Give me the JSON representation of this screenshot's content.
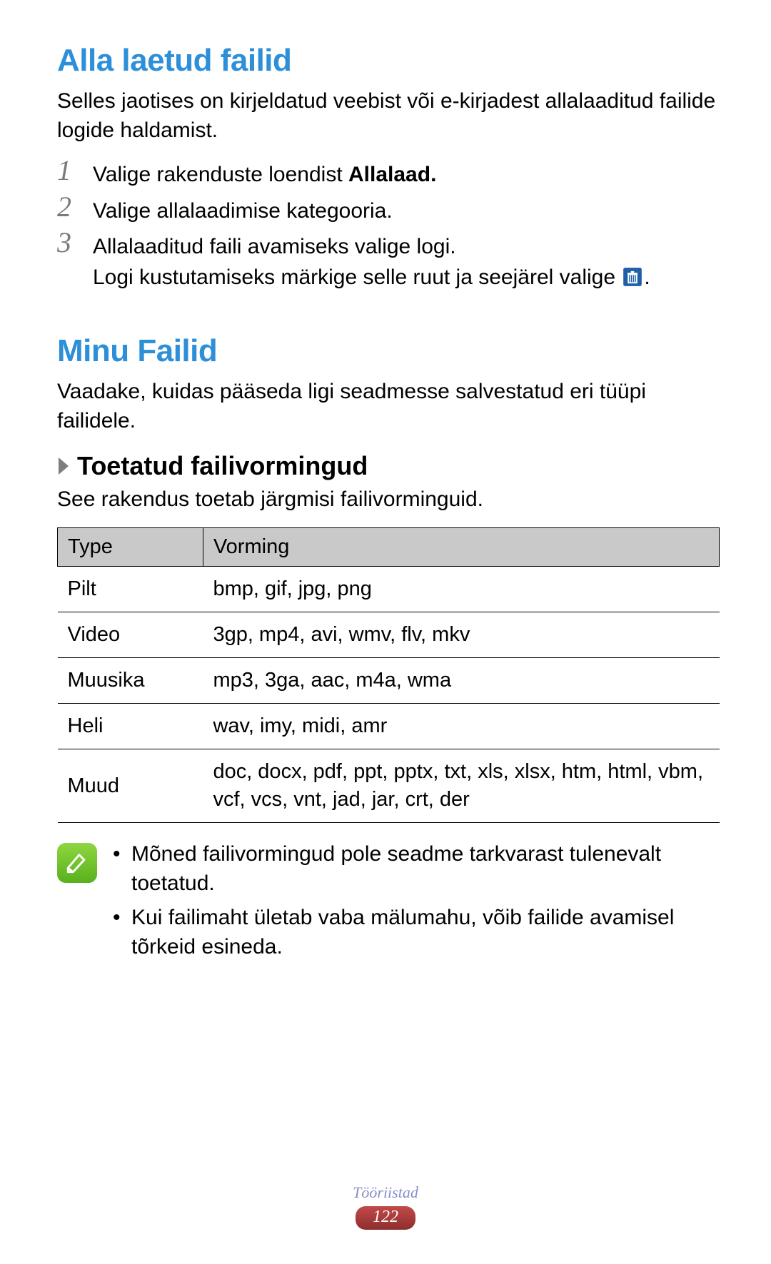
{
  "sections": {
    "downloads": {
      "title": "Alla laetud failid",
      "intro": "Selles jaotises on kirjeldatud veebist või e-kirjadest allalaaditud failide logide haldamist.",
      "steps": [
        {
          "prefix": "Valige rakenduste loendist ",
          "bold": "Allalaad."
        },
        {
          "text": "Valige allalaadimise kategooria."
        },
        {
          "text": "Allalaaditud faili avamiseks valige logi.",
          "sub_prefix": "Logi kustutamiseks märkige selle ruut ja seejärel valige ",
          "sub_icon": "trash-icon",
          "sub_suffix": "."
        }
      ]
    },
    "myfiles": {
      "title": "Minu Failid",
      "intro": "Vaadake, kuidas pääseda ligi seadmesse salvestatud eri tüüpi failidele.",
      "sub_title": "Toetatud failivormingud",
      "sub_intro": "See rakendus toetab järgmisi failivorminguid.",
      "table": {
        "headers": {
          "type": "Type",
          "format": "Vorming"
        },
        "rows": [
          {
            "type": "Pilt",
            "format": "bmp, gif, jpg, png"
          },
          {
            "type": "Video",
            "format": "3gp, mp4, avi, wmv, flv, mkv"
          },
          {
            "type": "Muusika",
            "format": "mp3, 3ga, aac, m4a, wma"
          },
          {
            "type": "Heli",
            "format": "wav, imy, midi, amr"
          },
          {
            "type": "Muud",
            "format": "doc, docx, pdf, ppt, pptx, txt, xls, xlsx, htm, html, vbm, vcf, vcs, vnt, jad, jar, crt, der"
          }
        ]
      },
      "notes": [
        "Mõned failivormingud pole seadme tarkvarast tulenevalt toetatud.",
        "Kui failimaht ületab vaba mälumahu, võib failide avamisel tõrkeid esineda."
      ]
    }
  },
  "footer": {
    "section_label": "Tööriistad",
    "page_number": "122"
  }
}
